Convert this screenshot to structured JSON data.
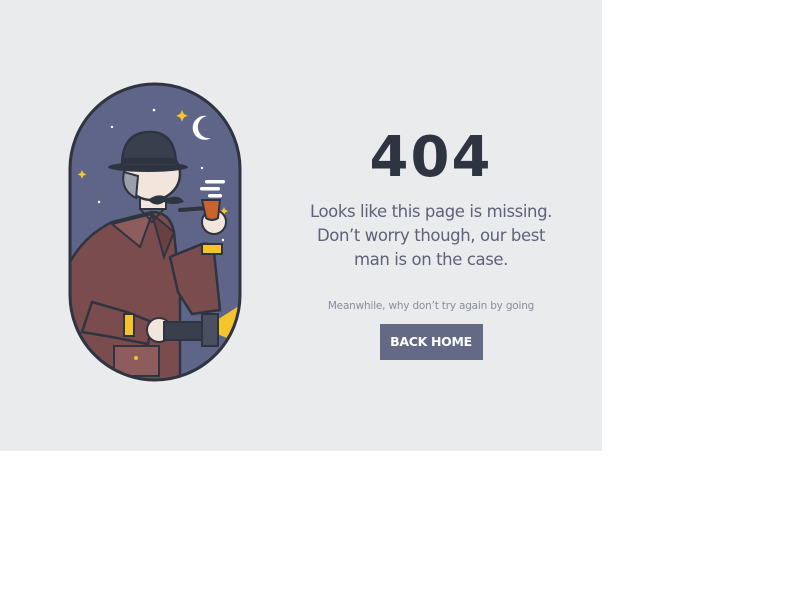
{
  "error_page": {
    "code": "404",
    "message_line1": "Looks like this page is missing.",
    "message_line2": "Don’t worry though, our best",
    "message_line3": "man is on the case.",
    "hint": "Meanwhile, why don’t try again by going",
    "back_home_label": "BACK HOME"
  },
  "illustration": {
    "subject": "detective-with-pipe-and-flashlight-icon"
  },
  "colors": {
    "panel_background": "#eaebed",
    "heading": "#2f3441",
    "message_text": "#5f6179",
    "hint_text": "#8a8d9c",
    "button_background": "#646a85",
    "button_text": "#ffffff",
    "night_sky": "#5f6589",
    "coat": "#7a4c4e",
    "flashlight_beam": "#f4c52a"
  }
}
